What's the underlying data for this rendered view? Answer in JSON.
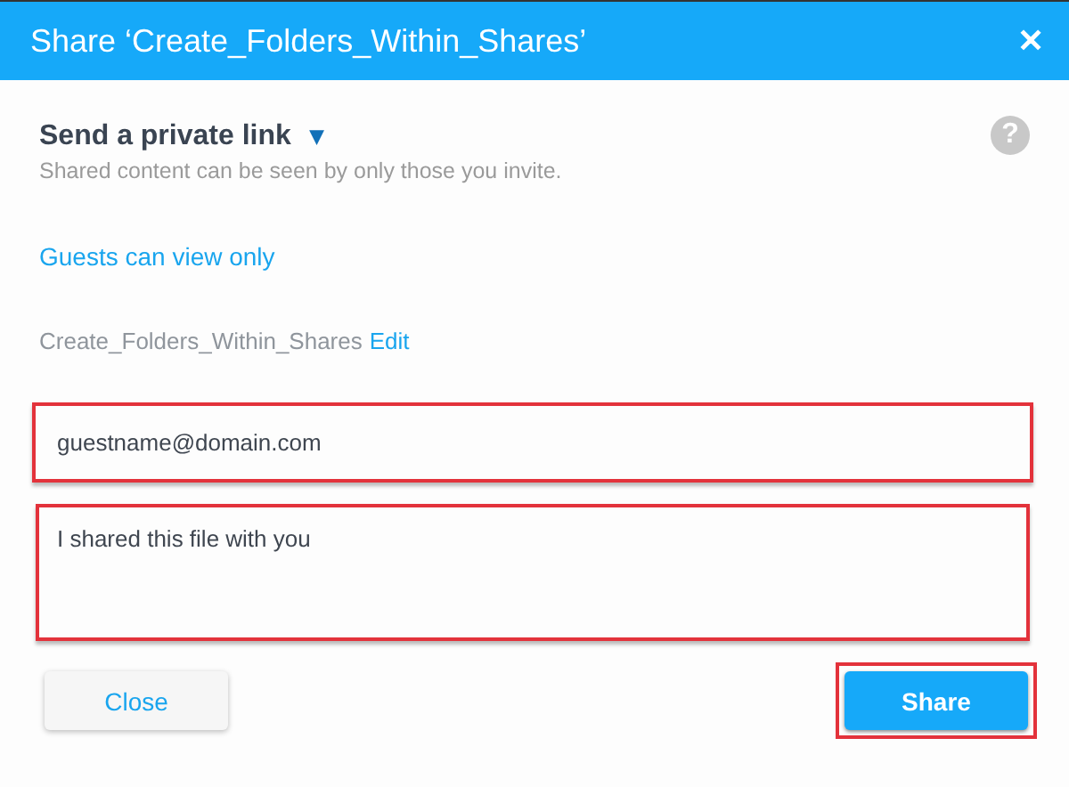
{
  "window": {
    "title": "Share ‘Create_Folders_Within_Shares’",
    "close": "✕"
  },
  "mode": {
    "label": "Send a private link",
    "caret": "▾",
    "help": "?",
    "description": "Shared content can be seen by only those you invite."
  },
  "permission_link": "Guests can view only",
  "file": {
    "name": "Create_Folders_Within_Shares",
    "edit_link": "Edit"
  },
  "email_field": {
    "value": "guestname@domain.com",
    "highlighted": true
  },
  "message_field": {
    "value": "I shared this file with you",
    "highlighted": true
  },
  "buttons": [
    {
      "label": "Close",
      "kind": "secondary",
      "highlighted": false
    },
    {
      "label": "Share",
      "kind": "primary",
      "highlighted": true
    }
  ]
}
